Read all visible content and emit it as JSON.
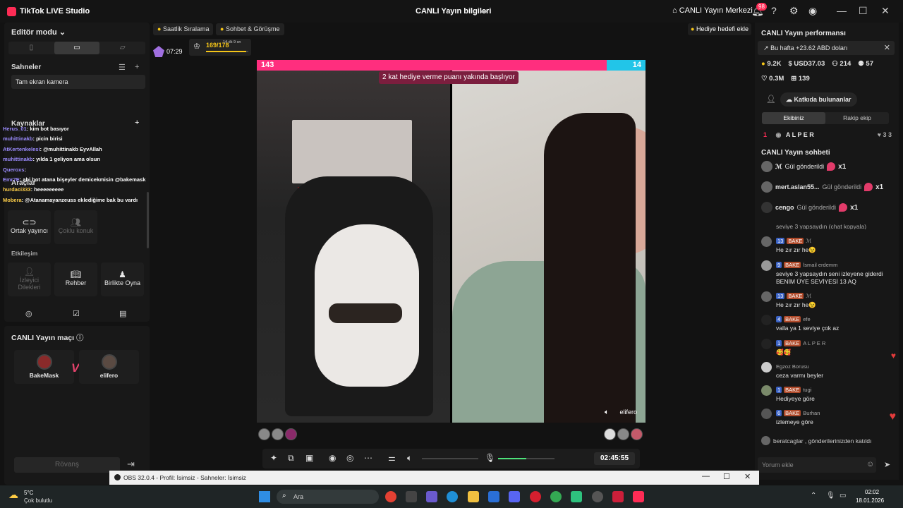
{
  "titlebar": {
    "app_title": "TikTok LIVE Studio",
    "live_info": "CANLI Yayın bilgileri",
    "live_center": "CANLI Yayın Merkezi",
    "notif_count": "98"
  },
  "left": {
    "editor_mode": "Editör modu ⌄",
    "scenes_title": "Sahneler",
    "scene_item": "Tam ekran kamera",
    "sources_title": "Kaynaklar",
    "tools_title": "Araçlar",
    "tools": [
      {
        "label": "Ortak yayıncı",
        "icon": "link-icon"
      },
      {
        "label": "Çoklu konuk",
        "icon": "users-icon"
      }
    ],
    "interaction_title": "Etkileşim",
    "interaction": [
      {
        "label": "İzleyici Dilekleri",
        "icon": "wishlist-icon"
      },
      {
        "label": "Rehber",
        "icon": "guide-icon"
      },
      {
        "label": "Birlikte Oyna",
        "icon": "play-together-icon"
      }
    ],
    "chat_overlay": [
      {
        "user": "Herus_01",
        "msg": ": kim bot basıyor"
      },
      {
        "user": "muhittinakb",
        "msg": ": picin birisi"
      },
      {
        "user": "AtKertenkelesi",
        "msg": ": @muhittinakb EyvAllah"
      },
      {
        "user": "muhittinakb",
        "msg": ": yılda 1 geliyon ama olsun"
      },
      {
        "user": "Queroxs",
        "msg": ":"
      },
      {
        "user": "Emr7E",
        "msg": ": abi bot atana bişeyler demicekmisin @bakemask"
      },
      {
        "user": "hurdaci333",
        "msg": ": heeeeeeeee"
      },
      {
        "user": "Mobera",
        "msg": ": @Atanamayanzeuss eklediğime bak bu vardı"
      }
    ]
  },
  "match": {
    "title": "CANLI Yayın maçı",
    "player1": "BakeMask",
    "player2": "elifero",
    "vs": "VS",
    "revenge": "Rövanş"
  },
  "topbar": {
    "hourly_rank": "Saatlik Sıralama",
    "chat_meet": "Sohbet & Görüşme",
    "timer": "07:29",
    "goal_count": "169/178",
    "goal_left": "14 dk 9 sn",
    "goal_progress": 0.95,
    "gift_goal": "Hediye hedefi ekle"
  },
  "stage": {
    "score_left": "143",
    "score_right": "14",
    "banner": "2 kat hediye verme puanı yakında başlıyor",
    "right_name": "elifero"
  },
  "controls": {
    "timer": "02:45:55",
    "mic_level": 0.5
  },
  "right": {
    "title": "CANLI Yayın performansı",
    "week": "Bu hafta +23.62 ABD doları",
    "stats1": [
      "9.2K",
      "USD37.03",
      "214",
      "57"
    ],
    "stats2": [
      "0.3M",
      "139"
    ],
    "contributors": "Katkıda bulunanlar",
    "tab_ours": "Ekibiniz",
    "tab_rival": "Rakip ekip",
    "rank_n": "1",
    "rank_name": "A L P E R",
    "rank_scores": "3  3",
    "chat_title": "CANLI Yayın sohbeti",
    "gifts": [
      {
        "name": "ℳ",
        "act": "Gül gönderildi",
        "count": "x1"
      },
      {
        "name": "mert.aslan55...",
        "act": "Gül gönderildi",
        "count": "x1"
      },
      {
        "name": "cengo",
        "act": "Gül gönderildi",
        "count": "x1"
      }
    ],
    "cut_line": "seviye 3 yapsaydın (chat kopyala)",
    "messages": [
      {
        "level": "13",
        "fan": "BAKE",
        "user": "ℳ",
        "text": "He zır zır he😉"
      },
      {
        "level": "9",
        "fan": "BAKE",
        "user": "İsmail erdemm",
        "text": "seviye 3 yapsaydın seni izleyene giderdi BENİM ÜYE SEVİYESİ 13 AQ"
      },
      {
        "level": "13",
        "fan": "BAKE",
        "user": "ℳ",
        "text": "He zır zır he😉"
      },
      {
        "level": "4",
        "fan": "BAKE",
        "user": "efe",
        "text": "valla ya 1 seviye çok az"
      },
      {
        "level": "1",
        "fan": "BAKE",
        "user": "A L P E R",
        "text": "🥰🥰"
      },
      {
        "level": "",
        "fan": "",
        "user": "Egzoz Borusu",
        "text": "ceza varmı beyler"
      },
      {
        "level": "1",
        "fan": "BAKE",
        "user": "tugi",
        "text": "Hediyeye göre"
      },
      {
        "level": "6",
        "fan": "BAKE",
        "user": "Burhan",
        "text": "izlemeye göre"
      }
    ],
    "joined": "beratcaglar , gönderilerinizden katıldı",
    "comment_placeholder": "Yorum ekle"
  },
  "obs": {
    "label": "OBS 32.0.4 - Profil: İsimsiz - Sahneler: İsimsiz"
  },
  "taskbar": {
    "temp": "5°C",
    "weather": "Çok bulutlu",
    "search": "Ara",
    "time": "02:02",
    "date": "18.01.2026"
  }
}
